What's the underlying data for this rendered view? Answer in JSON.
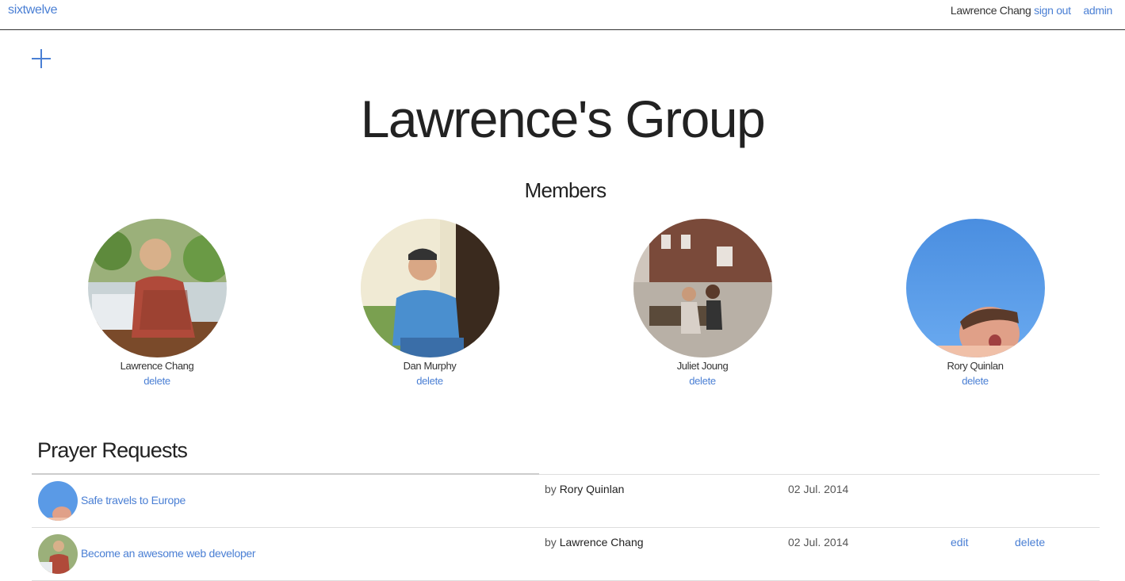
{
  "nav": {
    "brand": "sixtwelve",
    "user_name": "Lawrence Chang",
    "sign_out": "sign out",
    "admin": "admin"
  },
  "group": {
    "title": "Lawrence's Group",
    "members_heading": "Members"
  },
  "members": [
    {
      "name": "Lawrence Chang",
      "delete": "delete"
    },
    {
      "name": "Dan Murphy",
      "delete": "delete"
    },
    {
      "name": "Juliet Joung",
      "delete": "delete"
    },
    {
      "name": "Rory Quinlan",
      "delete": "delete"
    }
  ],
  "prayer_requests": {
    "heading": "Prayer Requests",
    "rows": [
      {
        "title": "Safe travels to Europe",
        "by": "by",
        "author": "Rory Quinlan",
        "date": "02 Jul. 2014"
      },
      {
        "title": "Become an awesome web developer",
        "by": "by",
        "author": "Lawrence Chang",
        "date": "02 Jul. 2014",
        "edit": "edit",
        "delete": "delete"
      }
    ]
  },
  "icons": {
    "add": "plus-icon"
  },
  "colors": {
    "accent": "#4a7fd4",
    "text": "#222222"
  }
}
